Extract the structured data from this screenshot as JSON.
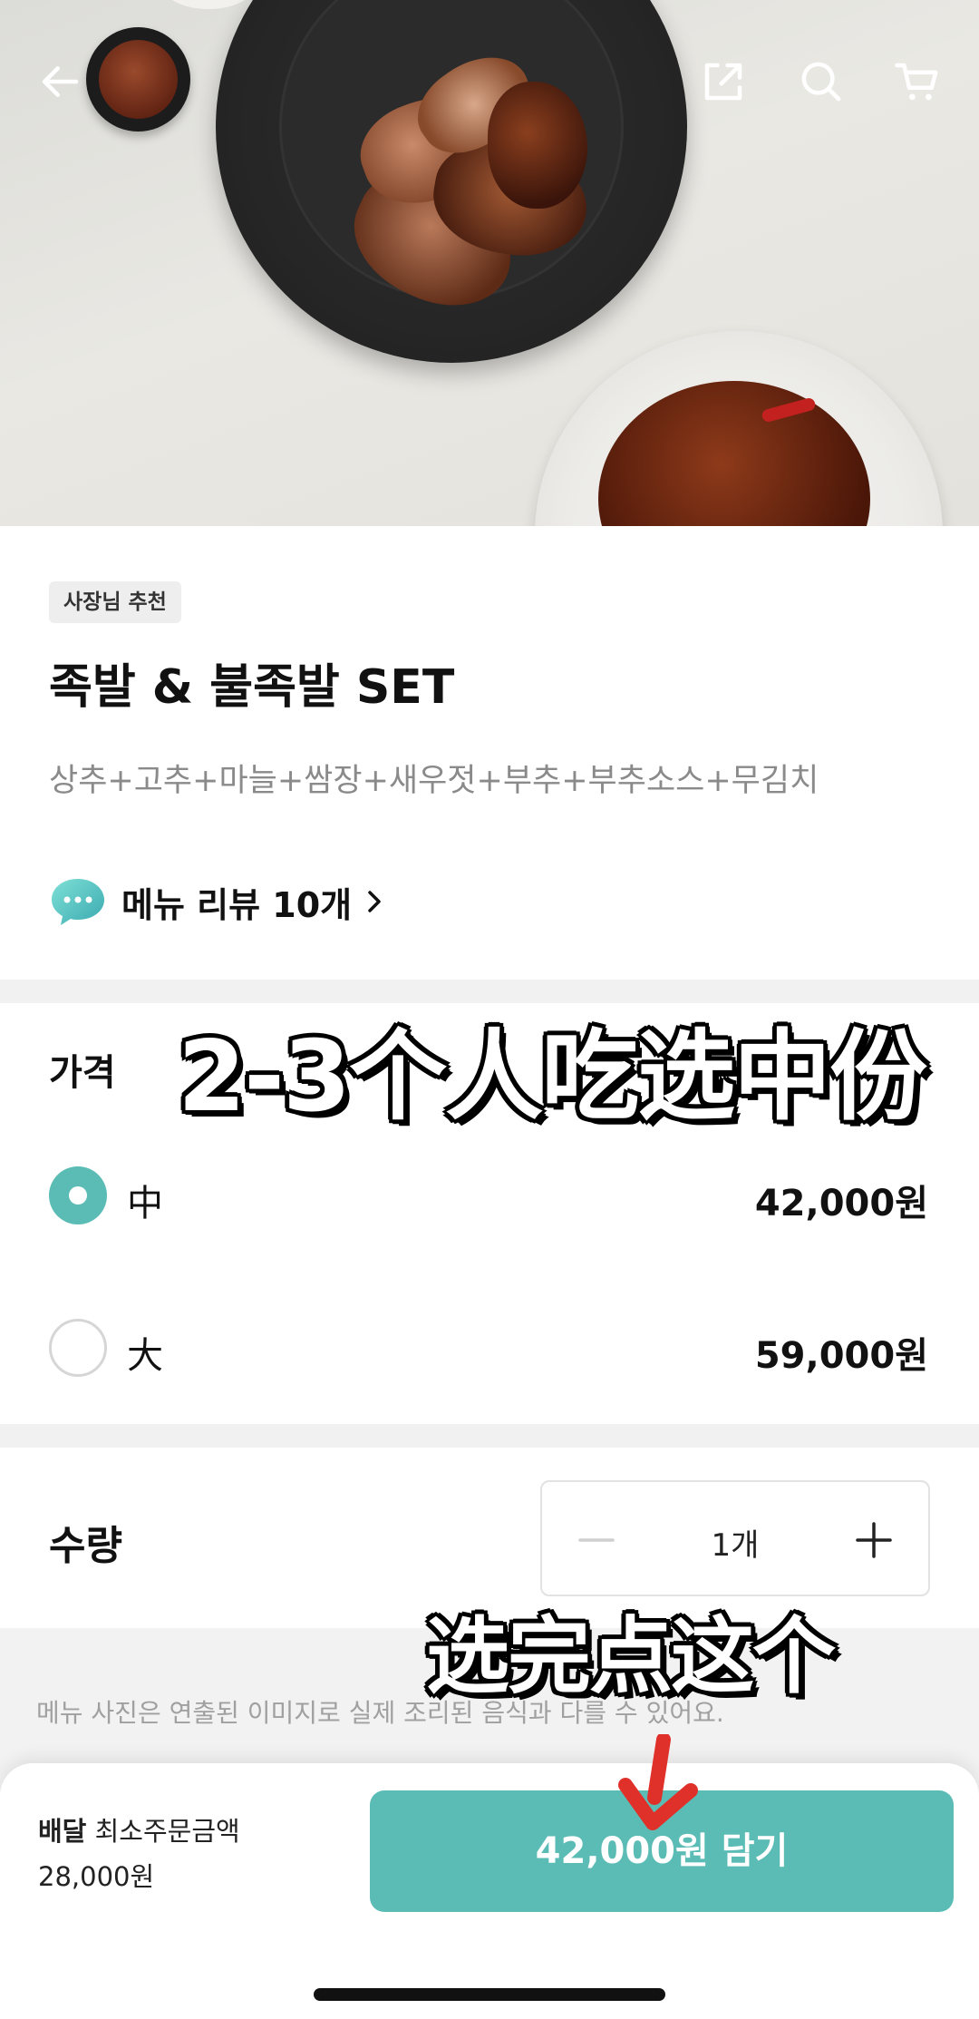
{
  "nav": {
    "back_icon": "back-arrow-icon",
    "share_icon": "share-icon",
    "search_icon": "search-icon",
    "cart_icon": "cart-icon"
  },
  "menu": {
    "badge": "사장님 추천",
    "title": "족발 & 불족발 SET",
    "description": "상추+고추+마늘+쌈장+새우젓+부추+부추소스+무김치",
    "review_label": "메뉴 리뷰 10개"
  },
  "price": {
    "label": "가격",
    "options": [
      {
        "label": "中",
        "price": "42,000원",
        "selected": true
      },
      {
        "label": "大",
        "price": "59,000원",
        "selected": false
      }
    ]
  },
  "quantity": {
    "label": "수량",
    "value": "1개"
  },
  "notice": "메뉴 사진은 연출된 이미지로 실제 조리된 음식과 다를 수 있어요.",
  "bottom_bar": {
    "delivery_label": "배달",
    "min_order_label": "최소주문금액",
    "min_order_amount": "28,000원",
    "add_button": "42,000원 담기"
  },
  "overlay": {
    "caption_top": "2-3个人吃选中份",
    "caption_bottom": "选完点这个"
  },
  "colors": {
    "accent": "#5bbcb6",
    "arrow": "#e0302a"
  }
}
